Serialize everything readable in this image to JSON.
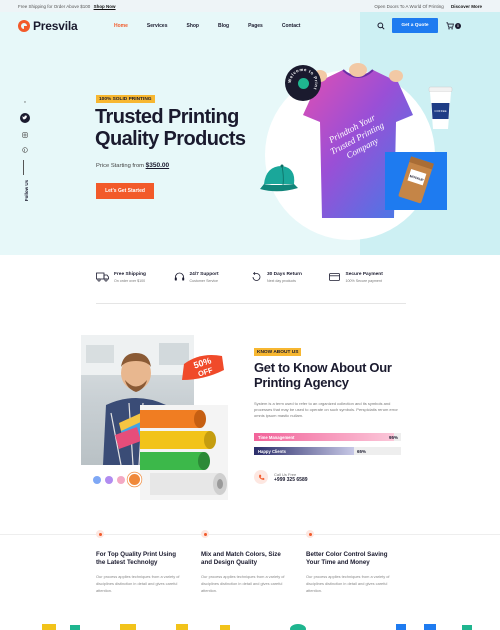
{
  "topbar": {
    "shipping_text": "Free Shipping for Order Above $100",
    "shop_now": "Shop Now",
    "promo_text": "Open Doors To A World Of Printing",
    "discover": "Discover More"
  },
  "header": {
    "brand": "Presvila",
    "nav": [
      "Home",
      "Services",
      "Shop",
      "Blog",
      "Pages",
      "Contact"
    ],
    "active_nav": "Home",
    "quote_button": "Get a Quote",
    "cart_count": "0"
  },
  "social": {
    "icons": [
      "vimeo-icon",
      "twitter-icon",
      "instagram-icon",
      "pinterest-icon"
    ],
    "follow_label": "Follow Us"
  },
  "hero": {
    "badge": "100% SOLID PRINTING",
    "title_line1": "Trusted Printing",
    "title_line2": "Quality Products",
    "price_label": "Price Starting from",
    "price": "$350.00",
    "cta": "Let's Get Started",
    "tshirt_print": "Prindtoh Your Trusted Printing Company",
    "mockup_label": "MOCKUP",
    "stamp_text": "Welcome to Print"
  },
  "features": [
    {
      "title": "Free Shipping",
      "desc": "On order over $100",
      "icon": "truck-icon"
    },
    {
      "title": "24/7 Support",
      "desc": "Customer Service",
      "icon": "headset-icon"
    },
    {
      "title": "30 Days Return",
      "desc": "Next day products",
      "icon": "return-icon"
    },
    {
      "title": "Secure Payment",
      "desc": "100% Secure payment",
      "icon": "card-icon"
    }
  ],
  "about": {
    "badge": "KNOW ABOUT US",
    "title_line1": "Get to Know About Our",
    "title_line2": "Printing Agency",
    "text": "System is a term used to refer to an organized collection and its symbols and processes that may be used to operate on such symbols. Perspiciatis rerum error omnis ipsum mastic nullam.",
    "discount_line1": "50%",
    "discount_line2": "OFF",
    "skills": [
      {
        "label": "Time Management",
        "percent": 95,
        "display": "95%"
      },
      {
        "label": "Happy Clients",
        "percent": 68,
        "display": "65%"
      }
    ],
    "call_label": "Call Us Free",
    "phone": "+999 325 6589",
    "swatch_colors": [
      "#7fa8f5",
      "#b18cf0",
      "#f3a9c4",
      "#f0893a"
    ]
  },
  "cards": [
    {
      "title": "For Top Quality Print Using the Latest Technolgy",
      "text": "Our process applies techniques from a variety of disciplines distinction in detail and gives careful attention."
    },
    {
      "title": "Mix and Match Colors, Size and Design Quality",
      "text": "Our process applies techniques from a variety of disciplines distinction in detail and gives careful attention."
    },
    {
      "title": "Better Color Control Saving Your Time and Money",
      "text": "Our process applies techniques from a variety of disciplines distinction in detail and gives careful attention."
    }
  ],
  "colors": {
    "accent": "#f25a2a",
    "primary_blue": "#1e7bf0",
    "badge_yellow": "#f7b731",
    "hero_bg": "#e7f8f9"
  }
}
